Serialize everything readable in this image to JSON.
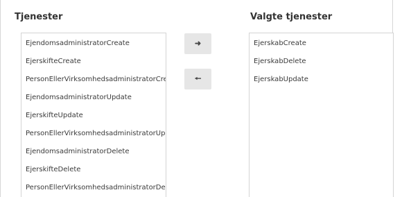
{
  "available": {
    "title": "Tjenester",
    "items": [
      "EjendomsadministratorCreate",
      "EjerskifteCreate",
      "PersonEllerVirksomhedsadministratorCreate",
      "EjendomsadministratorUpdate",
      "EjerskifteUpdate",
      "PersonEllerVirksomhedsadministratorUpdate",
      "EjendomsadministratorDelete",
      "EjerskifteDelete",
      "PersonEllerVirksomhedsadministratorDelete"
    ]
  },
  "selected": {
    "title": "Valgte tjenester",
    "items": [
      "EjerskabCreate",
      "EjerskabDelete",
      "EjerskabUpdate"
    ]
  },
  "buttons": {
    "add_icon": "arrow-right-icon",
    "remove_icon": "arrow-left-icon"
  }
}
